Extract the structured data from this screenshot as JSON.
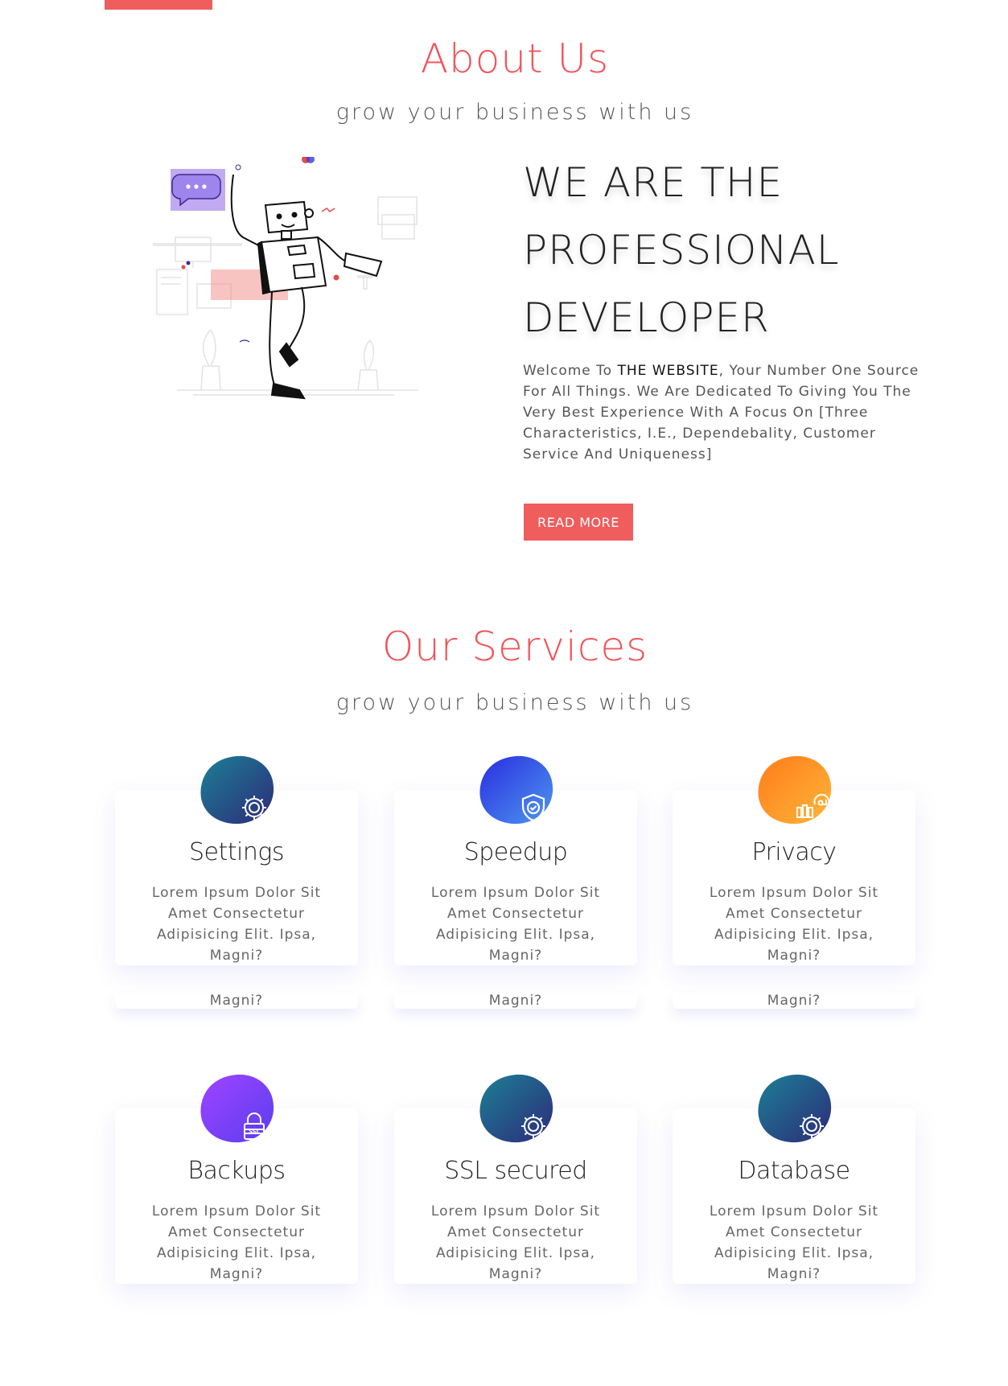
{
  "about": {
    "title": "About Us",
    "subtitle": "grow your business with us",
    "headline": [
      "WE ARE THE",
      "PROFESSIONAL",
      "DEVELOPER"
    ],
    "desc_prefix": "Welcome To ",
    "desc_brand": "THE WEBSITE",
    "desc_suffix": ", Your Number One Source For All Things. We Are Dedicated To Giving You The Very Best Experience With A Focus On [Three Characteristics, I.E., Dependebality, Customer Service And Uniqueness]",
    "read_more": "READ MORE"
  },
  "services": {
    "title": "Our Services",
    "subtitle": "grow your business with us",
    "cards": [
      {
        "title": "Settings",
        "text": "Lorem Ipsum Dolor Sit Amet Consectetur Adipisicing Elit. Ipsa, Magni?",
        "icon": "gear-icon",
        "colors": [
          "#1c7f95",
          "#2d2b7a"
        ]
      },
      {
        "title": "Speedup",
        "text": "Lorem Ipsum Dolor Sit Amet Consectetur Adipisicing Elit. Ipsa, Magni?",
        "icon": "shield-check-icon",
        "colors": [
          "#2a2de0",
          "#4d97f0"
        ]
      },
      {
        "title": "Privacy",
        "text": "Lorem Ipsum Dolor Sit Amet Consectetur Adipisicing Elit. Ipsa, Magni?",
        "icon": "chart-refresh-icon",
        "colors": [
          "#ff7b1a",
          "#ffb63a"
        ]
      },
      {
        "title": "Backups",
        "text": "Lorem Ipsum Dolor Sit Amet Consectetur Adipisicing Elit. Ipsa, Magni?",
        "icon": "ssl-lock-icon",
        "colors": [
          "#a044ff",
          "#5a3df0"
        ]
      },
      {
        "title": "SSL secured",
        "text": "Lorem Ipsum Dolor Sit Amet Consectetur Adipisicing Elit. Ipsa, Magni?",
        "icon": "gear-icon",
        "colors": [
          "#1c7f95",
          "#2d2b7a"
        ]
      },
      {
        "title": "Database",
        "text": "Lorem Ipsum Dolor Sit Amet Consectetur Adipisicing Elit. Ipsa, Magni?",
        "icon": "gear-icon",
        "colors": [
          "#1c7f95",
          "#2d2b7a"
        ]
      }
    ],
    "overflow_text": "Magni?"
  },
  "colors": {
    "accent": "#ef5d5d",
    "title": "#f0555c"
  }
}
